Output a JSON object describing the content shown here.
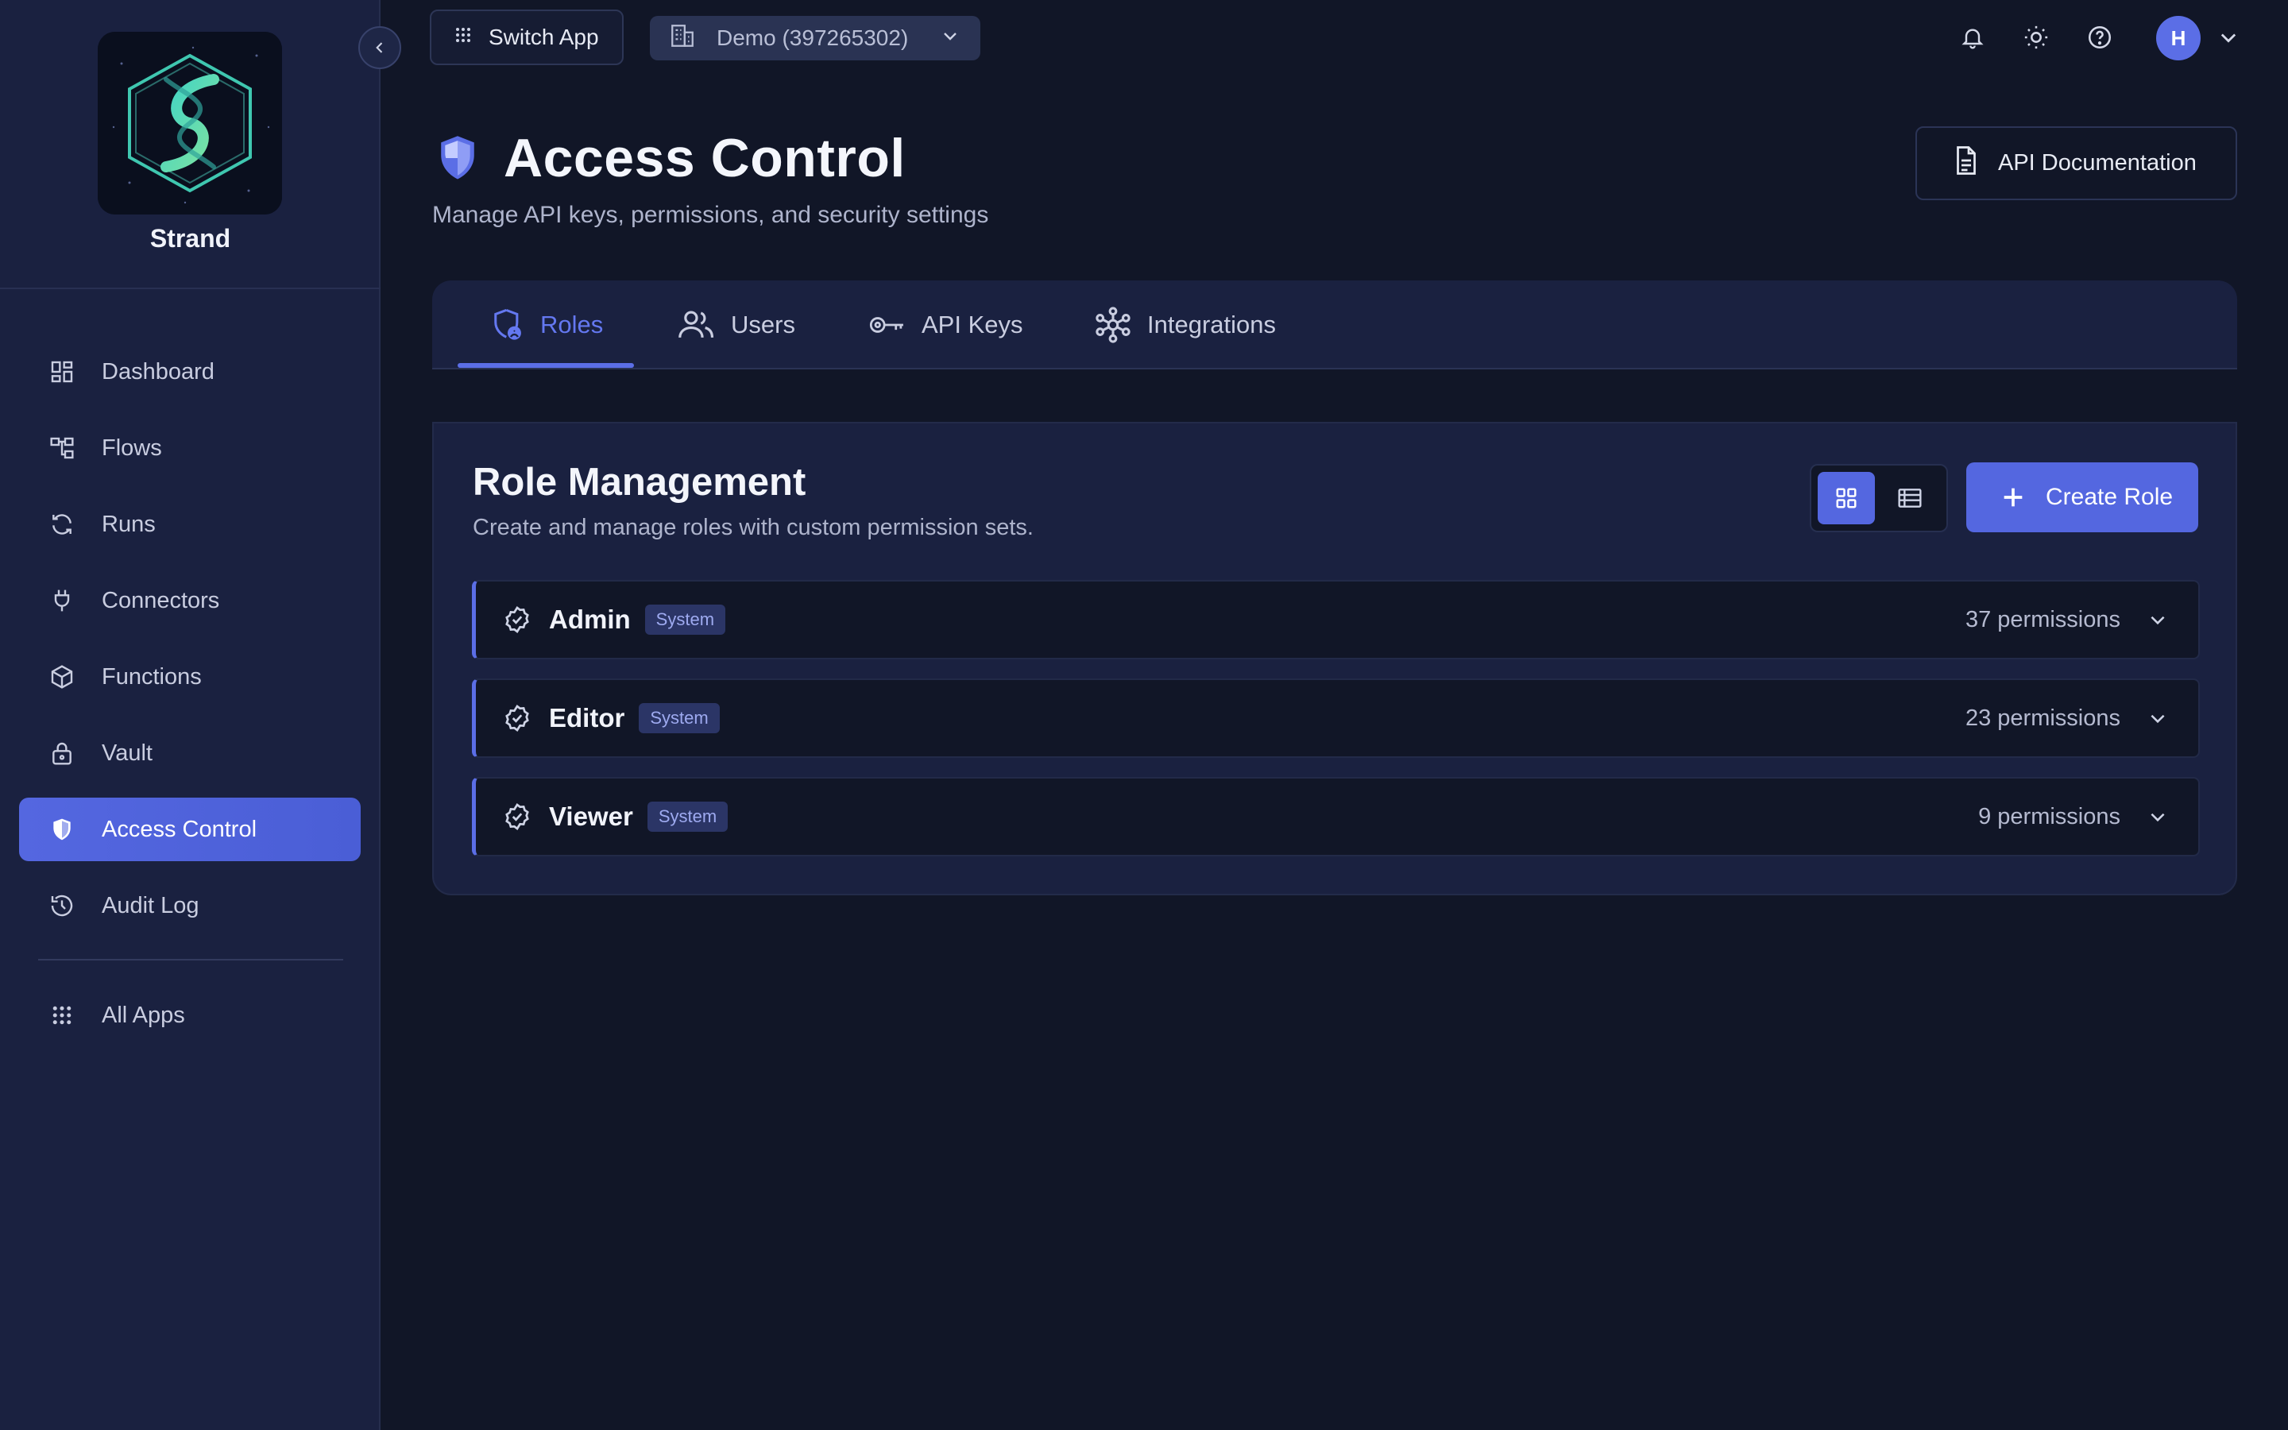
{
  "brand": {
    "name": "Strand"
  },
  "sidebar": {
    "collapse_label": "‹",
    "items": [
      {
        "label": "Dashboard",
        "icon": "dashboard-icon",
        "active": false
      },
      {
        "label": "Flows",
        "icon": "flows-icon",
        "active": false
      },
      {
        "label": "Runs",
        "icon": "runs-icon",
        "active": false
      },
      {
        "label": "Connectors",
        "icon": "plug-icon",
        "active": false
      },
      {
        "label": "Functions",
        "icon": "cube-icon",
        "active": false
      },
      {
        "label": "Vault",
        "icon": "lock-icon",
        "active": false
      },
      {
        "label": "Access Control",
        "icon": "shield-icon",
        "active": true
      },
      {
        "label": "Audit Log",
        "icon": "history-icon",
        "active": false
      }
    ],
    "extra": [
      {
        "label": "All Apps",
        "icon": "grid-dots-icon"
      }
    ]
  },
  "topbar": {
    "switch_app_label": "Switch App",
    "tenant_label": "Demo (397265302)",
    "avatar_initial": "H"
  },
  "page": {
    "title": "Access Control",
    "subtitle": "Manage API keys, permissions, and security settings",
    "api_doc_label": "API Documentation"
  },
  "tabs": [
    {
      "label": "Roles",
      "icon": "shield-user-icon",
      "active": true
    },
    {
      "label": "Users",
      "icon": "users-icon",
      "active": false
    },
    {
      "label": "API Keys",
      "icon": "key-icon",
      "active": false
    },
    {
      "label": "Integrations",
      "icon": "network-icon",
      "active": false
    }
  ],
  "roles_card": {
    "title": "Role Management",
    "subtitle": "Create and manage roles with custom permission sets.",
    "create_label": "Create Role",
    "roles": [
      {
        "name": "Admin",
        "badge": "System",
        "permissions": "37 permissions"
      },
      {
        "name": "Editor",
        "badge": "System",
        "permissions": "23 permissions"
      },
      {
        "name": "Viewer",
        "badge": "System",
        "permissions": "9 permissions"
      }
    ]
  },
  "colors": {
    "accent": "#5467e0",
    "sidebar_bg": "#1a2140",
    "page_bg": "#111627"
  }
}
